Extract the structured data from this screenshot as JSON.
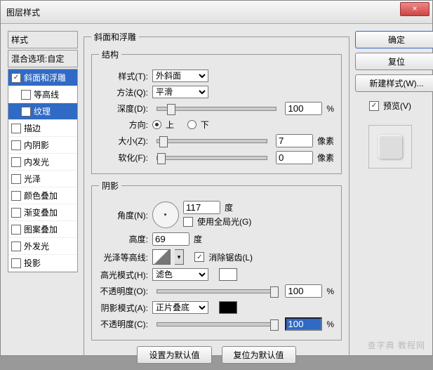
{
  "title": "图层样式",
  "styles": {
    "header": "样式",
    "blend": "混合选项:自定",
    "items": [
      {
        "label": "斜面和浮雕",
        "checked": true,
        "selected": true
      },
      {
        "label": "等高线",
        "checked": false,
        "selected": false,
        "sub": true
      },
      {
        "label": "纹理",
        "checked": false,
        "selected": true,
        "sub": true
      },
      {
        "label": "描边",
        "checked": false
      },
      {
        "label": "内阴影",
        "checked": false
      },
      {
        "label": "内发光",
        "checked": false
      },
      {
        "label": "光泽",
        "checked": false
      },
      {
        "label": "颜色叠加",
        "checked": false
      },
      {
        "label": "渐变叠加",
        "checked": false
      },
      {
        "label": "图案叠加",
        "checked": false
      },
      {
        "label": "外发光",
        "checked": false
      },
      {
        "label": "投影",
        "checked": false
      }
    ]
  },
  "bevel": {
    "group": "斜面和浮雕",
    "structure": {
      "legend": "结构",
      "style": {
        "label": "样式(T):",
        "value": "外斜面"
      },
      "technique": {
        "label": "方法(Q):",
        "value": "平滑"
      },
      "depth": {
        "label": "深度(D):",
        "value": "100",
        "unit": "%"
      },
      "direction": {
        "label": "方向:",
        "up": "上",
        "down": "下",
        "value": "up"
      },
      "size": {
        "label": "大小(Z):",
        "value": "7",
        "unit": "像素"
      },
      "soften": {
        "label": "软化(F):",
        "value": "0",
        "unit": "像素"
      }
    },
    "shading": {
      "legend": "阴影",
      "angle": {
        "label": "角度(N):",
        "value": "117",
        "unit": "度"
      },
      "global": {
        "label": "使用全局光(G)",
        "checked": false
      },
      "altitude": {
        "label": "高度:",
        "value": "69",
        "unit": "度"
      },
      "gloss": {
        "label": "光泽等高线:",
        "aa": "消除锯齿(L)",
        "aa_checked": true
      },
      "hmode": {
        "label": "高光模式(H):",
        "value": "滤色"
      },
      "hopacity": {
        "label": "不透明度(O):",
        "value": "100",
        "unit": "%"
      },
      "smode": {
        "label": "阴影模式(A):",
        "value": "正片叠底"
      },
      "sopacity": {
        "label": "不透明度(C):",
        "value": "100",
        "unit": "%"
      }
    },
    "buttons": {
      "default": "设置为默认值",
      "reset": "复位为默认值"
    }
  },
  "right": {
    "ok": "确定",
    "cancel": "复位",
    "newstyle": "新建样式(W)...",
    "preview": {
      "label": "预览(V)",
      "checked": true
    }
  },
  "watermark": "查字典 教程网"
}
